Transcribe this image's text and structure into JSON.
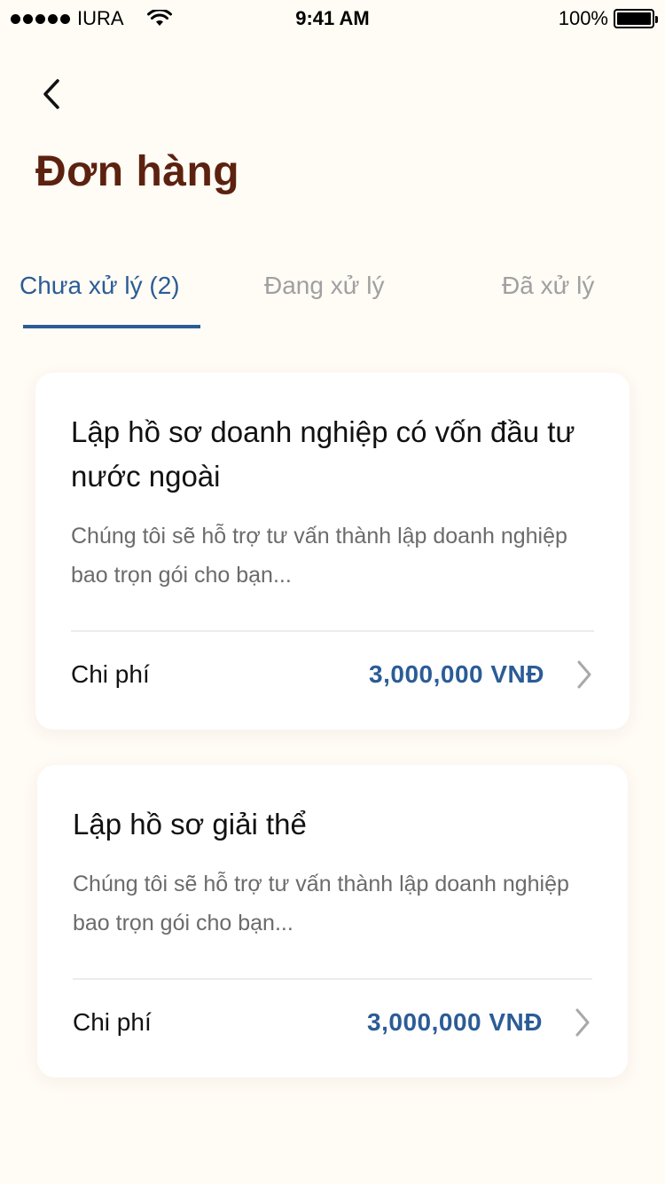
{
  "status_bar": {
    "carrier": "IURA",
    "time": "9:41 AM",
    "battery": "100%"
  },
  "header": {
    "title": "Đơn hàng"
  },
  "tabs": [
    {
      "label": "Chưa xử lý (2)",
      "active": true
    },
    {
      "label": "Đang xử lý",
      "active": false
    },
    {
      "label": "Đã xử lý",
      "active": false
    }
  ],
  "orders": [
    {
      "title": "Lập hồ sơ doanh nghiệp có vốn đầu tư nước ngoài",
      "description": "Chúng tôi sẽ hỗ trợ tư vấn thành lập doanh nghiệp bao trọn gói cho bạn...",
      "cost_label": "Chi phí",
      "cost_value": "3,000,000 VNĐ"
    },
    {
      "title": "Lập hồ sơ giải thể",
      "description": "Chúng tôi sẽ hỗ trợ tư vấn thành lập doanh nghiệp bao trọn gói cho bạn...",
      "cost_label": "Chi phí",
      "cost_value": "3,000,000 VNĐ"
    }
  ],
  "colors": {
    "background": "#fffbf5",
    "title": "#5c220f",
    "accent": "#2b5c96",
    "inactive_tab": "#a0a0a0"
  },
  "icons": [
    "signal-dots-icon",
    "wifi-icon",
    "battery-icon",
    "back-arrow-icon",
    "chevron-right-icon"
  ]
}
